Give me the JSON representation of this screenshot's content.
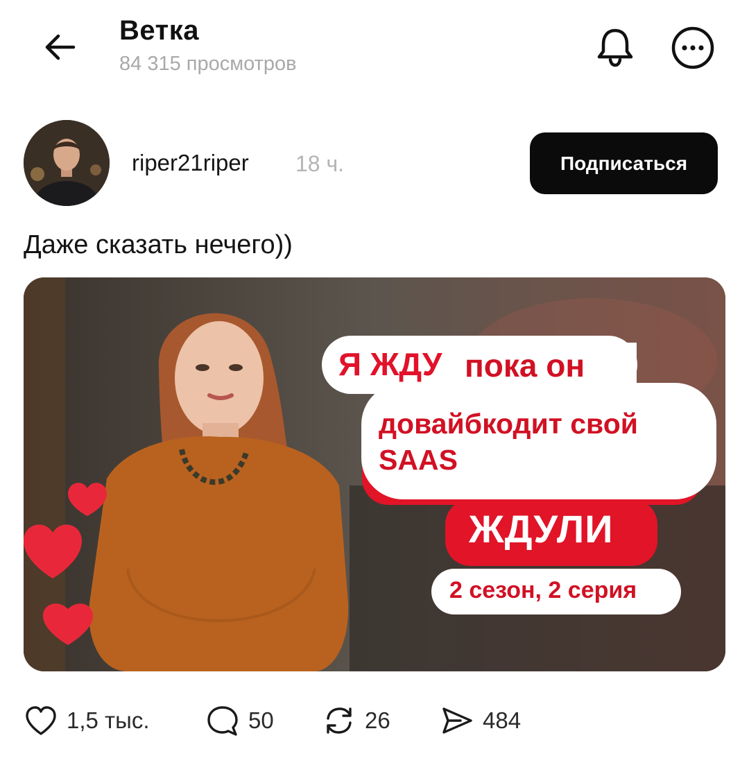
{
  "header": {
    "title": "Ветка",
    "views": "84 315 просмотров",
    "icons": {
      "back": "arrow-left-icon",
      "bell": "bell-icon",
      "more": "more-horizontal-icon"
    }
  },
  "post": {
    "author": {
      "username": "riper21riper",
      "time": "18 ч."
    },
    "subscribe_label": "Подписаться",
    "text": "Даже сказать нечего))",
    "image": {
      "caption_line1_a": "Я ЖДУ",
      "caption_line1_b": "пока он",
      "caption_line2": "довайбкодит свой",
      "caption_line3": "SAAS",
      "show_title": "ЖДУЛИ",
      "episode": "2 сезон, 2 серия"
    },
    "actions": {
      "likes": "1,5 тыс.",
      "comments": "50",
      "reposts": "26",
      "shares": "484"
    }
  },
  "colors": {
    "accent_red": "#e11428",
    "button_bg": "#0b0b0b",
    "muted_text": "#a9a9a9"
  }
}
